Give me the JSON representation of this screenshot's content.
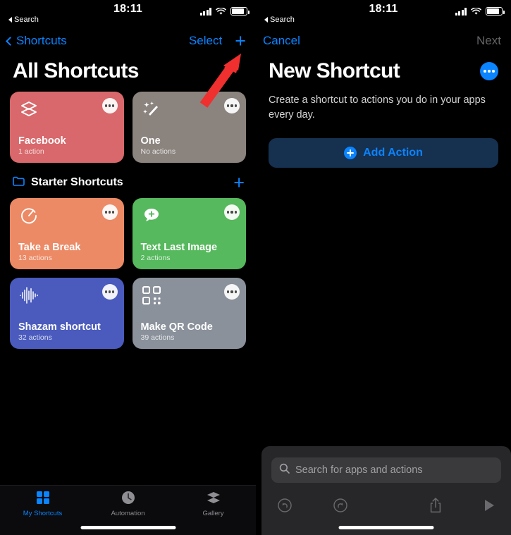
{
  "status_bar": {
    "time": "18:11",
    "back_label": "Search",
    "icons": [
      "cellular-signal-icon",
      "wifi-icon",
      "battery-icon"
    ]
  },
  "left_screen": {
    "nav": {
      "back_label": "Shortcuts",
      "select_label": "Select",
      "add_icon": "plus-icon"
    },
    "page_title": "All Shortcuts",
    "all_shortcuts": [
      {
        "name": "Facebook",
        "subtitle": "1 action",
        "color": "#d8686b",
        "icon": "layers-icon"
      },
      {
        "name": "One",
        "subtitle": "No actions",
        "color": "#8b837e",
        "icon": "magic-wand-icon"
      }
    ],
    "section": {
      "icon": "folder-icon",
      "title": "Starter Shortcuts",
      "add_icon": "plus-icon"
    },
    "starter_shortcuts": [
      {
        "name": "Take a Break",
        "subtitle": "13 actions",
        "color": "#ec8a66",
        "icon": "timer-icon"
      },
      {
        "name": "Text Last Image",
        "subtitle": "2 actions",
        "color": "#56b95d",
        "icon": "message-plus-icon"
      },
      {
        "name": "Shazam shortcut",
        "subtitle": "32 actions",
        "color": "#4a5bbd",
        "icon": "waveform-icon"
      },
      {
        "name": "Make QR Code",
        "subtitle": "39 actions",
        "color": "#8a919b",
        "icon": "qr-code-icon"
      }
    ],
    "tabs": [
      {
        "label": "My Shortcuts",
        "icon": "grid-icon",
        "active": true
      },
      {
        "label": "Automation",
        "icon": "clock-icon",
        "active": false
      },
      {
        "label": "Gallery",
        "icon": "layers-icon",
        "active": false
      }
    ]
  },
  "right_screen": {
    "nav": {
      "cancel_label": "Cancel",
      "next_label": "Next"
    },
    "page_title": "New Shortcut",
    "more_icon": "more-dots-icon",
    "description": "Create a shortcut to actions you do in your apps every day.",
    "add_action_label": "Add Action",
    "search": {
      "placeholder": "Search for apps and actions",
      "icon": "search-icon"
    },
    "toolbar": [
      {
        "icon": "undo-icon"
      },
      {
        "icon": "redo-icon"
      },
      {
        "icon": "share-icon"
      },
      {
        "icon": "play-icon"
      }
    ]
  },
  "annotation": {
    "type": "red-arrow",
    "color": "#f02f2f",
    "points_to": "plus-icon"
  },
  "colors": {
    "accent_blue": "#0a84ff",
    "background": "#000000",
    "dim_text": "#636366"
  }
}
